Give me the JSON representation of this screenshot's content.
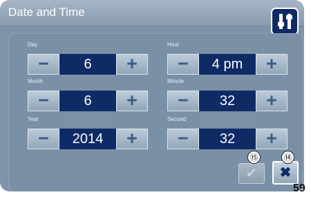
{
  "header": {
    "title": "Date and Time",
    "settings_icon": "settings-sliders-icon"
  },
  "fields": {
    "day": {
      "label": "Day",
      "value": "6"
    },
    "hour": {
      "label": "Hour",
      "value": "4 pm"
    },
    "month": {
      "label": "Month",
      "value": "6"
    },
    "minute": {
      "label": "Minute",
      "value": "32"
    },
    "year": {
      "label": "Year",
      "value": "2014"
    },
    "second": {
      "label": "Second",
      "value": "32"
    }
  },
  "stepper_symbols": {
    "minus": "−",
    "plus": "+"
  },
  "actions": {
    "confirm_symbol": "✔",
    "cancel_symbol": "✖"
  },
  "callouts": {
    "confirm": "⑮",
    "cancel": "⑭"
  },
  "page_number": "59",
  "colors": {
    "accent": "#0f2b66",
    "screen_bg": "#7f93a9",
    "button": "#a6b7c9"
  }
}
